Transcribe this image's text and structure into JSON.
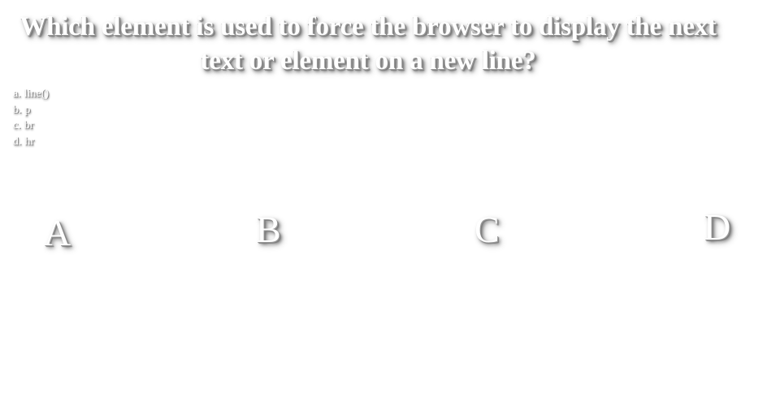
{
  "question": {
    "line1": "Which element is used to force the browser to display the next",
    "line2": "text or element on a new line?"
  },
  "options": [
    {
      "letter": "a.",
      "text": "line()"
    },
    {
      "letter": "b.",
      "text": "p"
    },
    {
      "letter": "c.",
      "text": "br"
    },
    {
      "letter": "d.",
      "text": "hr"
    }
  ],
  "answers": {
    "a": "A",
    "b": "B",
    "c": "C",
    "d": "D"
  },
  "colors": {
    "text": "#ffffff",
    "shadow": "#7a7a7a",
    "background": "#ffffff"
  }
}
